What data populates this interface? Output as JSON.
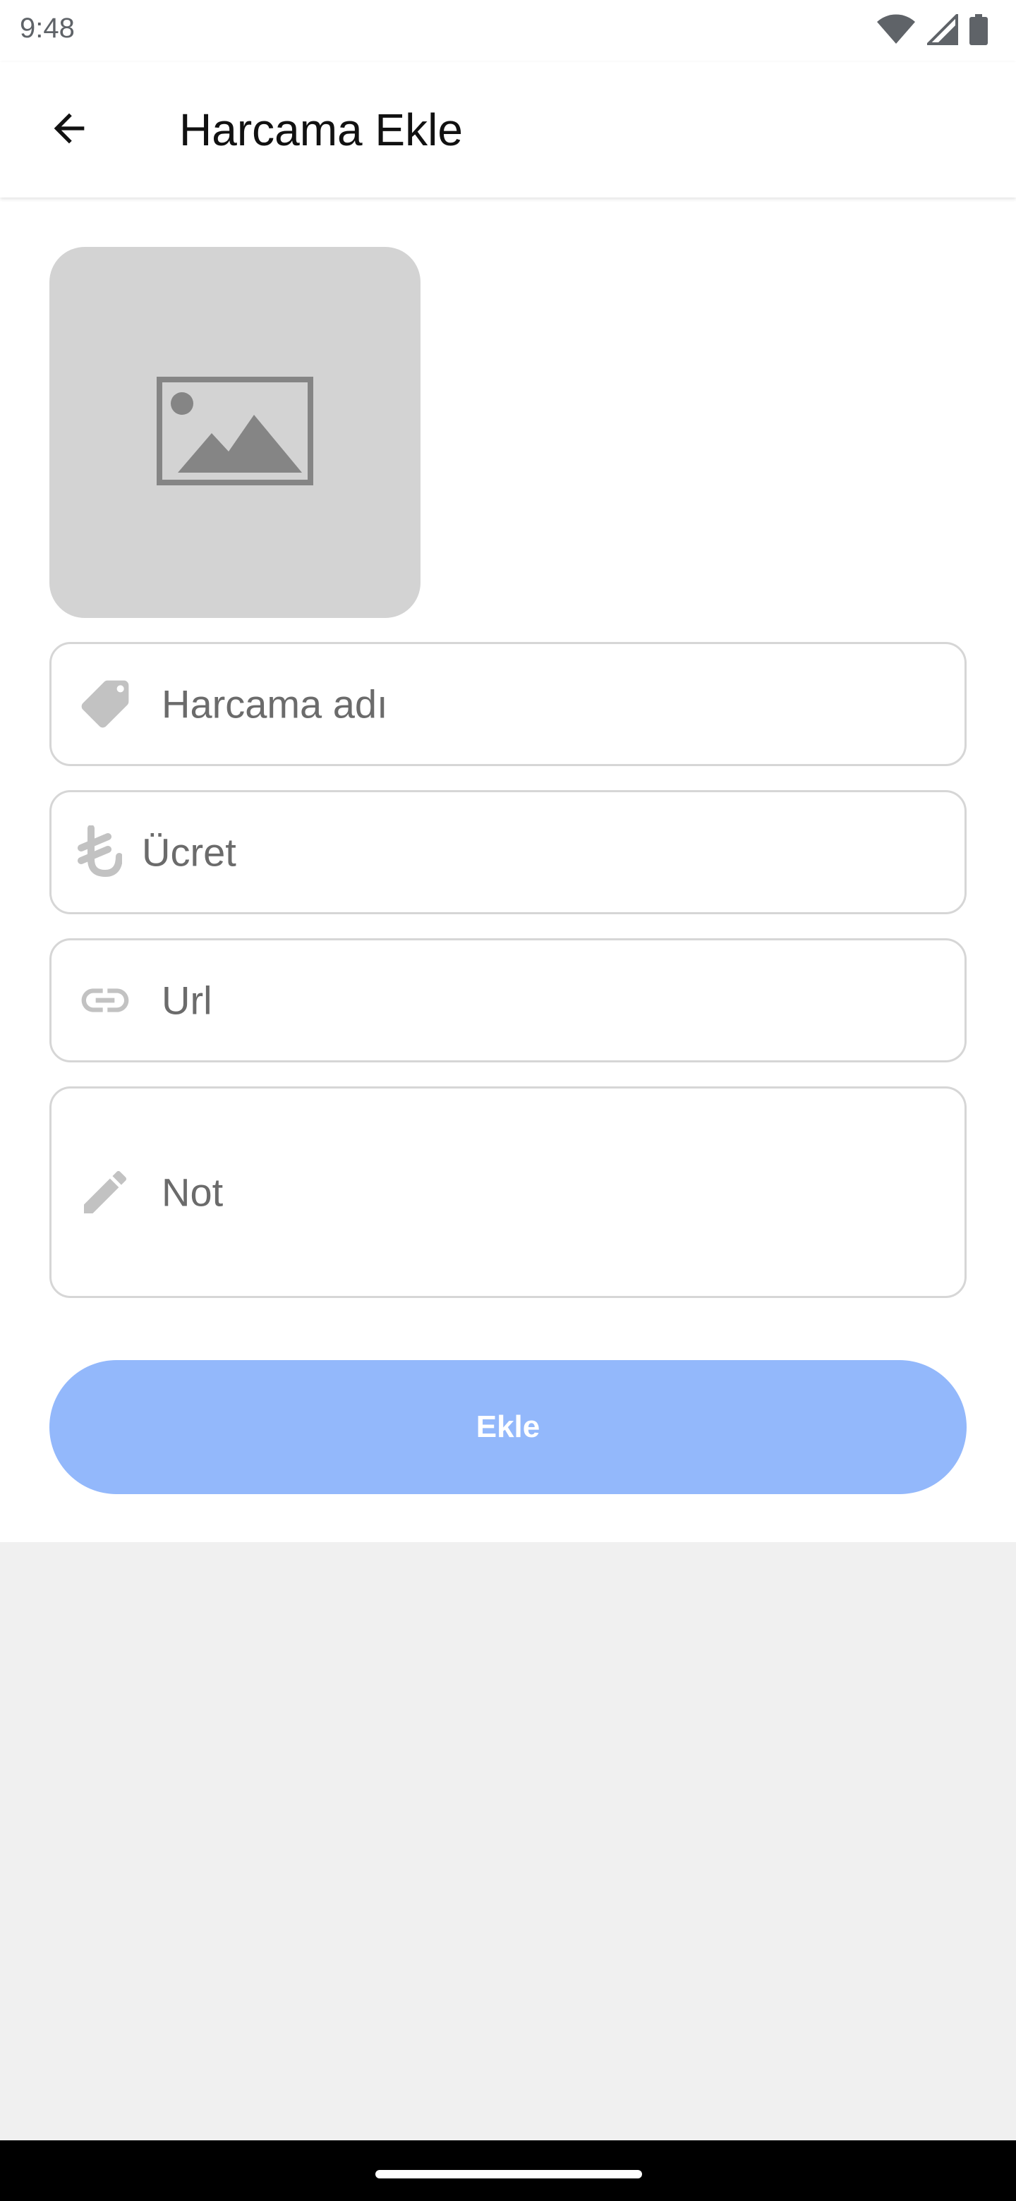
{
  "status_bar": {
    "time": "9:48",
    "icons": [
      "wifi-icon",
      "cellular-signal-icon",
      "battery-icon"
    ]
  },
  "app_bar": {
    "back_icon": "arrow-back-icon",
    "title": "Harcama Ekle"
  },
  "form": {
    "image_placeholder_icon": "image-placeholder-icon",
    "fields": [
      {
        "icon": "tag-icon",
        "placeholder": "Harcama adı",
        "value": ""
      },
      {
        "icon": "lira-icon",
        "placeholder": "Ücret",
        "value": ""
      },
      {
        "icon": "link-icon",
        "placeholder": "Url",
        "value": ""
      },
      {
        "icon": "pencil-icon",
        "placeholder": "Not",
        "value": ""
      }
    ],
    "submit_label": "Ekle"
  },
  "colors": {
    "button_disabled": "#93b8fb",
    "placeholder_box": "#d3d3d3",
    "field_border": "#d6d6d6",
    "icon_gray": "#c2c2c2"
  }
}
